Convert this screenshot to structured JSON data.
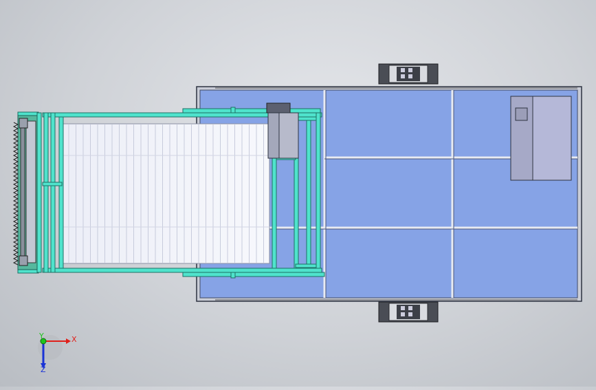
{
  "view": {
    "background": "#cfd2d7",
    "orientation": "top view",
    "triad": {
      "x_label": "X",
      "y_label": "Y",
      "z_label": "Z",
      "x_color": "#e0201b",
      "y_color": "#1ec41e",
      "z_color": "#1a33d6"
    }
  },
  "colors": {
    "platform_fill": "#86a3e6",
    "platform_border": "#2d3340",
    "frame_cyan": "#4fe3cc",
    "frame_stroke": "#1d6f63",
    "belt_fill": "#dfe2f0",
    "motor_box": "#b7bacb",
    "wheel_dark": "#3c3f47",
    "control_box": "#b5b8d8"
  }
}
